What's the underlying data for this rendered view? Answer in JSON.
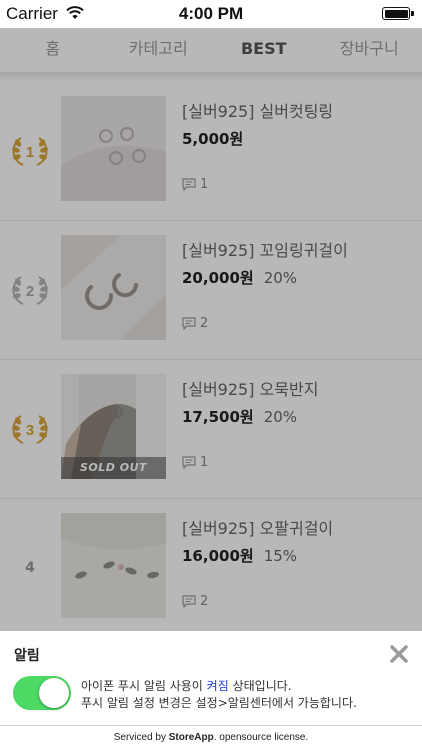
{
  "status_bar": {
    "carrier": "Carrier",
    "time": "4:00 PM"
  },
  "nav": {
    "tabs": [
      "홈",
      "카테고리",
      "BEST",
      "장바구니"
    ],
    "active_index": 2
  },
  "products": [
    {
      "rank": "1",
      "title": "[실버925] 실버컷팅링",
      "price": "5,000원",
      "discount": "",
      "comments": "1",
      "sold_out": ""
    },
    {
      "rank": "2",
      "title": "[실버925] 꼬임링귀걸이",
      "price": "20,000원",
      "discount": "20%",
      "comments": "2",
      "sold_out": ""
    },
    {
      "rank": "3",
      "title": "[실버925] 오묵반지",
      "price": "17,500원",
      "discount": "20%",
      "comments": "1",
      "sold_out": "SOLD OUT"
    },
    {
      "rank": "4",
      "title": "[실버925] 오팔귀걸이",
      "price": "16,000원",
      "discount": "15%",
      "comments": "2",
      "sold_out": ""
    }
  ],
  "alert": {
    "title": "알림",
    "line1_prefix": "아이폰 푸시 알림 사용이 ",
    "line1_status": "켜짐",
    "line1_suffix": " 상태입니다.",
    "line2": "푸시 알림 설정 변경은 설정>알림센터에서 가능합니다.",
    "toggle_on": true
  },
  "footer": {
    "prefix": "Serviced by ",
    "brand": "StoreApp",
    "suffix": ". opensource license."
  },
  "colors": {
    "toggle_on": "#4cd964",
    "laurel_gold": "#d9a43a",
    "laurel_silver": "#b5b5b5",
    "link_blue": "#1a3fcc"
  }
}
